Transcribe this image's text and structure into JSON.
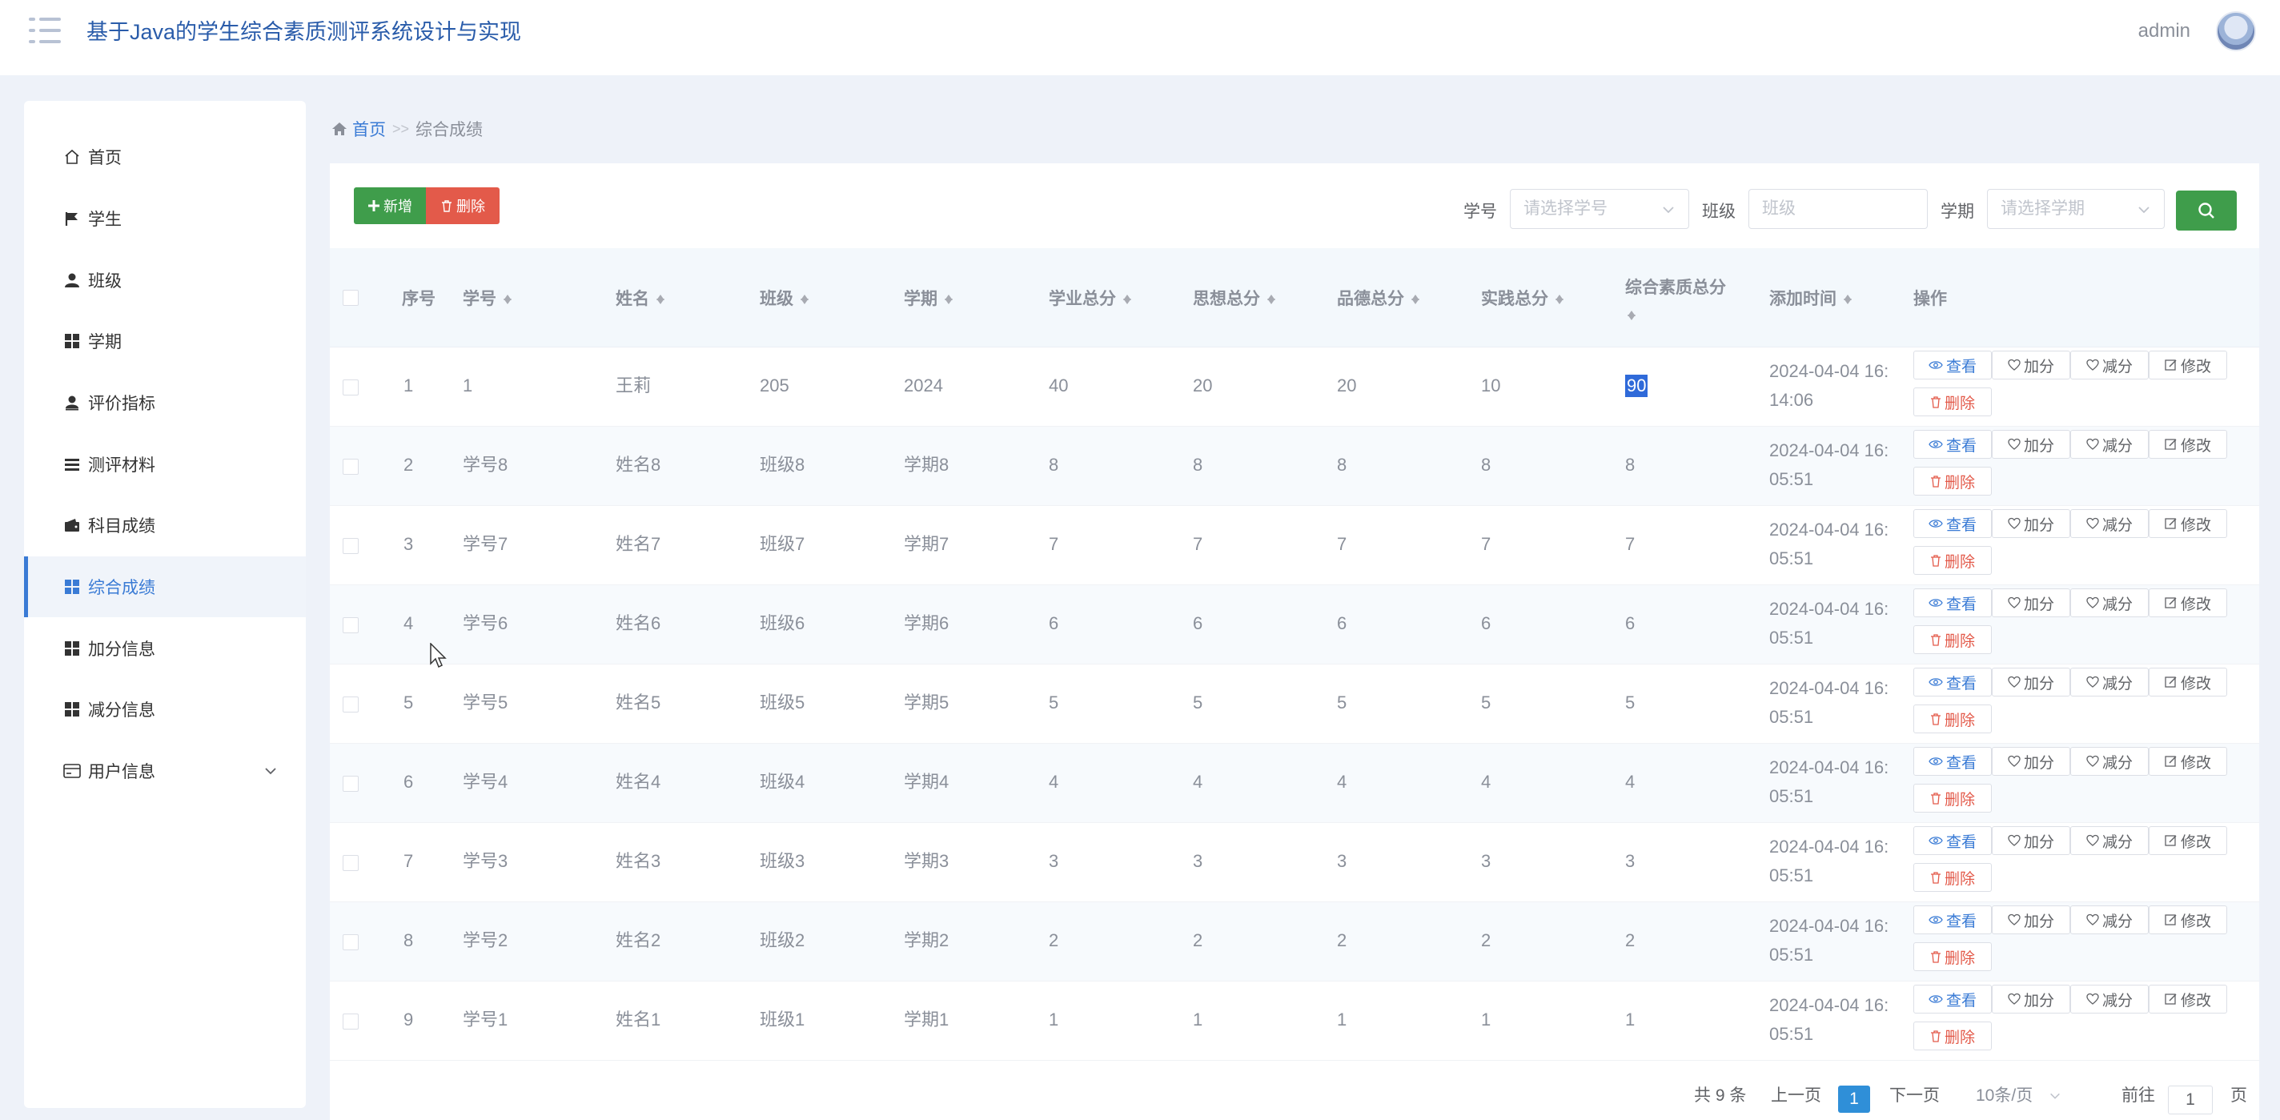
{
  "header": {
    "title": "基于Java的学生综合素质测评系统设计与实现",
    "user": "admin"
  },
  "sidebar": {
    "items": [
      {
        "label": "首页",
        "icon": "home-icon"
      },
      {
        "label": "学生",
        "icon": "flag-icon"
      },
      {
        "label": "班级",
        "icon": "user-icon"
      },
      {
        "label": "学期",
        "icon": "grid-icon"
      },
      {
        "label": "评价指标",
        "icon": "user-icon"
      },
      {
        "label": "测评材料",
        "icon": "list-icon"
      },
      {
        "label": "科目成绩",
        "icon": "wallet-icon"
      },
      {
        "label": "综合成绩",
        "icon": "grid-icon"
      },
      {
        "label": "加分信息",
        "icon": "grid-icon"
      },
      {
        "label": "减分信息",
        "icon": "grid-icon"
      },
      {
        "label": "用户信息",
        "icon": "card-icon"
      }
    ],
    "active_index": 7
  },
  "breadcrumb": {
    "home": "首页",
    "separator": ">>",
    "current": "综合成绩"
  },
  "toolbar": {
    "add_label": "新增",
    "delete_label": "删除"
  },
  "filters": {
    "student_id_label": "学号",
    "student_id_placeholder": "请选择学号",
    "class_label": "班级",
    "class_placeholder": "班级",
    "term_label": "学期",
    "term_placeholder": "请选择学期"
  },
  "table": {
    "columns": [
      "序号",
      "学号",
      "姓名",
      "班级",
      "学期",
      "学业总分",
      "思想总分",
      "品德总分",
      "实践总分",
      "综合素质总分",
      "添加时间",
      "操作"
    ],
    "rows": [
      {
        "no": "1",
        "id": "1",
        "name": "王莉",
        "cls": "205",
        "term": "2024",
        "academic": "40",
        "thought": "20",
        "moral": "20",
        "practice": "10",
        "total": "90",
        "time": "2024-04-04 16:14:06"
      },
      {
        "no": "2",
        "id": "学号8",
        "name": "姓名8",
        "cls": "班级8",
        "term": "学期8",
        "academic": "8",
        "thought": "8",
        "moral": "8",
        "practice": "8",
        "total": "8",
        "time": "2024-04-04 16:05:51"
      },
      {
        "no": "3",
        "id": "学号7",
        "name": "姓名7",
        "cls": "班级7",
        "term": "学期7",
        "academic": "7",
        "thought": "7",
        "moral": "7",
        "practice": "7",
        "total": "7",
        "time": "2024-04-04 16:05:51"
      },
      {
        "no": "4",
        "id": "学号6",
        "name": "姓名6",
        "cls": "班级6",
        "term": "学期6",
        "academic": "6",
        "thought": "6",
        "moral": "6",
        "practice": "6",
        "total": "6",
        "time": "2024-04-04 16:05:51"
      },
      {
        "no": "5",
        "id": "学号5",
        "name": "姓名5",
        "cls": "班级5",
        "term": "学期5",
        "academic": "5",
        "thought": "5",
        "moral": "5",
        "practice": "5",
        "total": "5",
        "time": "2024-04-04 16:05:51"
      },
      {
        "no": "6",
        "id": "学号4",
        "name": "姓名4",
        "cls": "班级4",
        "term": "学期4",
        "academic": "4",
        "thought": "4",
        "moral": "4",
        "practice": "4",
        "total": "4",
        "time": "2024-04-04 16:05:51"
      },
      {
        "no": "7",
        "id": "学号3",
        "name": "姓名3",
        "cls": "班级3",
        "term": "学期3",
        "academic": "3",
        "thought": "3",
        "moral": "3",
        "practice": "3",
        "total": "3",
        "time": "2024-04-04 16:05:51"
      },
      {
        "no": "8",
        "id": "学号2",
        "name": "姓名2",
        "cls": "班级2",
        "term": "学期2",
        "academic": "2",
        "thought": "2",
        "moral": "2",
        "practice": "2",
        "total": "2",
        "time": "2024-04-04 16:05:51"
      },
      {
        "no": "9",
        "id": "学号1",
        "name": "姓名1",
        "cls": "班级1",
        "term": "学期1",
        "academic": "1",
        "thought": "1",
        "moral": "1",
        "practice": "1",
        "total": "1",
        "time": "2024-04-04 16:05:51"
      }
    ],
    "actions": {
      "view": "查看",
      "add_points": "加分",
      "sub_points": "减分",
      "edit": "修改",
      "delete": "删除"
    }
  },
  "pagination": {
    "total": "共 9 条",
    "prev": "上一页",
    "current": "1",
    "next": "下一页",
    "page_size": "10条/页",
    "goto_label": "前往",
    "goto_value": "1",
    "goto_suffix": "页"
  }
}
